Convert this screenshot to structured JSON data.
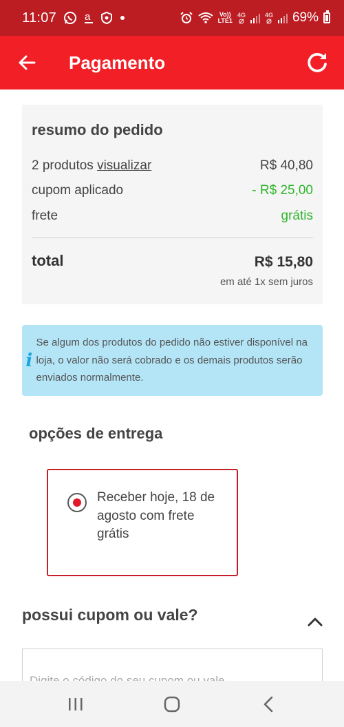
{
  "status_bar": {
    "time": "11:07",
    "volte_label_top": "Vo))",
    "volte_label_bottom": "LTE1",
    "net_label_1": "4G",
    "net_label_2": "4G",
    "battery": "69%"
  },
  "app_bar": {
    "title": "Pagamento",
    "back_icon": "arrow-left-icon",
    "refresh_icon": "refresh-icon",
    "background": "#f21f26"
  },
  "summary": {
    "title": "resumo do pedido",
    "products_label": "2 produtos",
    "view_link": "visualizar",
    "products_value": "R$ 40,80",
    "coupon_label": "cupom aplicado",
    "coupon_value": "- R$ 25,00",
    "shipping_label": "frete",
    "shipping_value": "grátis",
    "total_label": "total",
    "total_value": "R$ 15,80",
    "installments": "em até 1x sem juros"
  },
  "info": {
    "icon": "info-icon",
    "icon_glyph": "i",
    "text": "Se algum dos produtos do pedido não estiver disponível na loja, o valor não será cobrado e os demais produtos serão enviados normalmente."
  },
  "delivery": {
    "title": "opções de entrega",
    "option_label": "Receber hoje, 18 de agosto com frete grátis",
    "selected": true
  },
  "coupon": {
    "title": "possui cupom ou vale?",
    "placeholder": "Digite o código do seu cupom ou vale",
    "value": ""
  },
  "nav_bar": {
    "recents_icon": "recents-icon",
    "home_icon": "home-icon",
    "back_icon": "back-chevron-icon"
  },
  "colors": {
    "accent_red": "#f21f26",
    "status_red": "#bc1d23",
    "green": "#2fb52c",
    "info_blue": "#b3e5f7"
  }
}
